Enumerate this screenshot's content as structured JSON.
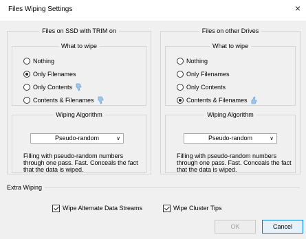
{
  "window": {
    "title": "Files Wiping Settings",
    "close_glyph": "×"
  },
  "ssd_panel": {
    "title": "Files on SSD with TRIM on",
    "what_title": "What to wipe",
    "options": [
      {
        "label": "Nothing",
        "checked": false,
        "thumb": ""
      },
      {
        "label": "Only Filenames",
        "checked": true,
        "thumb": ""
      },
      {
        "label": "Only Contents",
        "checked": false,
        "thumb": "thumbs-down"
      },
      {
        "label": "Contents & Filenames",
        "checked": false,
        "thumb": "thumbs-down"
      }
    ],
    "algo_title": "Wiping Algorithm",
    "algo_value": "Pseudo-random",
    "description": "Filling with pseudo-random numbers through one pass. Fast. Conceals the fact that the data is wiped."
  },
  "other_panel": {
    "title": "Files on other Drives",
    "what_title": "What to wipe",
    "options": [
      {
        "label": "Nothing",
        "checked": false,
        "thumb": ""
      },
      {
        "label": "Only Filenames",
        "checked": false,
        "thumb": ""
      },
      {
        "label": "Only Contents",
        "checked": false,
        "thumb": ""
      },
      {
        "label": "Contents & Filenames",
        "checked": true,
        "thumb": "thumbs-up"
      }
    ],
    "algo_title": "Wiping Algorithm",
    "algo_value": "Pseudo-random",
    "description": "Filling with pseudo-random numbers through one pass. Fast. Conceals the fact that the data is wiped."
  },
  "extra": {
    "title": "Extra Wiping",
    "ads_label": "Wipe Alternate Data Streams",
    "ads_checked": true,
    "tips_label": "Wipe Cluster Tips",
    "tips_checked": true
  },
  "buttons": {
    "ok": "OK",
    "cancel": "Cancel"
  },
  "colors": {
    "thumb": "#6fa8dc",
    "accent": "#0078d7"
  }
}
